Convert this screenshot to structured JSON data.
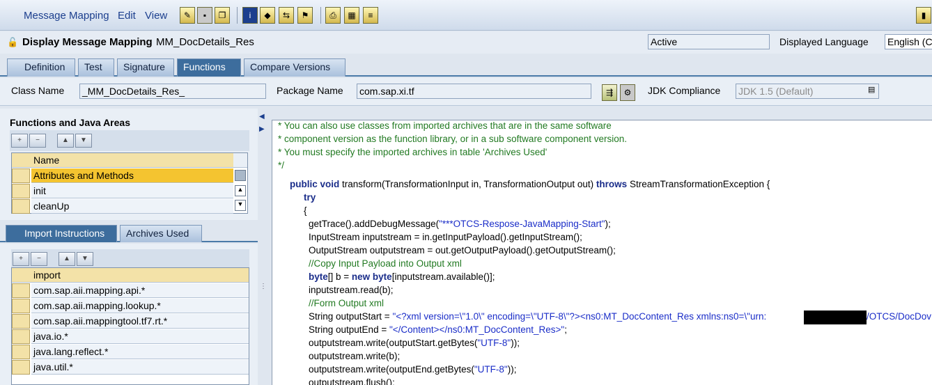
{
  "menu": {
    "items": [
      "Message Mapping",
      "Edit",
      "View"
    ]
  },
  "header": {
    "title": "Display Message Mapping",
    "object_name": "MM_DocDetails_Res",
    "status": "Active",
    "language_label": "Displayed Language",
    "language_value": "English (C"
  },
  "tabs": [
    "Definition",
    "Test",
    "Signature",
    "Functions",
    "Compare Versions"
  ],
  "class_row": {
    "class_label": "Class Name",
    "class_value": "_MM_DocDetails_Res_",
    "package_label": "Package Name",
    "package_value": "com.sap.xi.tf",
    "jdk_label": "JDK Compliance",
    "jdk_value": "JDK 1.5 (Default)"
  },
  "functions_panel": {
    "title": "Functions and Java Areas",
    "column": "Name",
    "rows": [
      "Attributes and Methods",
      "init",
      "cleanUp"
    ]
  },
  "import_tabs": [
    "Import Instructions",
    "Archives Used"
  ],
  "import_panel": {
    "column": "import",
    "rows": [
      "com.sap.aii.mapping.api.*",
      "com.sap.aii.mapping.lookup.*",
      "com.sap.aii.mappingtool.tf7.rt.*",
      "java.io.*",
      "java.lang.reflect.*",
      "java.util.*"
    ]
  },
  "code": {
    "c1": "* You can also use classes from imported archives that are in the same software",
    "c2": "* component version as the function library, or in a sub software component version.",
    "c3": "* You must specify the imported archives in table 'Archives Used'",
    "c4": "*/",
    "l1a": "public void",
    "l1b": " transform(TransformationInput in, TransformationOutput out) ",
    "l1c": "throws",
    "l1d": " StreamTransformationException {",
    "l2": "try",
    "l3": "{",
    "l4a": "getTrace().addDebugMessage(",
    "l4b": "\"***OTCS-Respose-JavaMapping-Start\"",
    "l4c": ");",
    "l5": "InputStream inputstream = in.getInputPayload().getInputStream();",
    "l6": "OutputStream outputstream = out.getOutputPayload().getOutputStream();",
    "l7": "//Copy Input Payload into Output xml",
    "l8a": "byte",
    "l8b": "[] b = ",
    "l8c": "new byte",
    "l8d": "[inputstream.available()];",
    "l9": "inputstream.read(b);",
    "l10": "//Form Output xml",
    "l11a": "String outputStart = ",
    "l11b": "\"<?xml version=\\\"1.0\\\" encoding=\\\"UTF-8\\\"?><ns0:MT_DocContent_Res xmlns:ns0=\\\"urn:",
    "l11c": "/OTCS/DocDov",
    "l12a": "String outputEnd = ",
    "l12b": "\"</Content></ns0:MT_DocContent_Res>\"",
    "l12c": ";",
    "l13a": "outputstream.write(outputStart.getBytes(",
    "l13b": "\"UTF-8\"",
    "l13c": "));",
    "l14": "outputstream.write(b);",
    "l15a": "outputstream.write(outputEnd.getBytes(",
    "l15b": "\"UTF-8\"",
    "l15c": "));",
    "l16": "outputstream.flush();"
  }
}
